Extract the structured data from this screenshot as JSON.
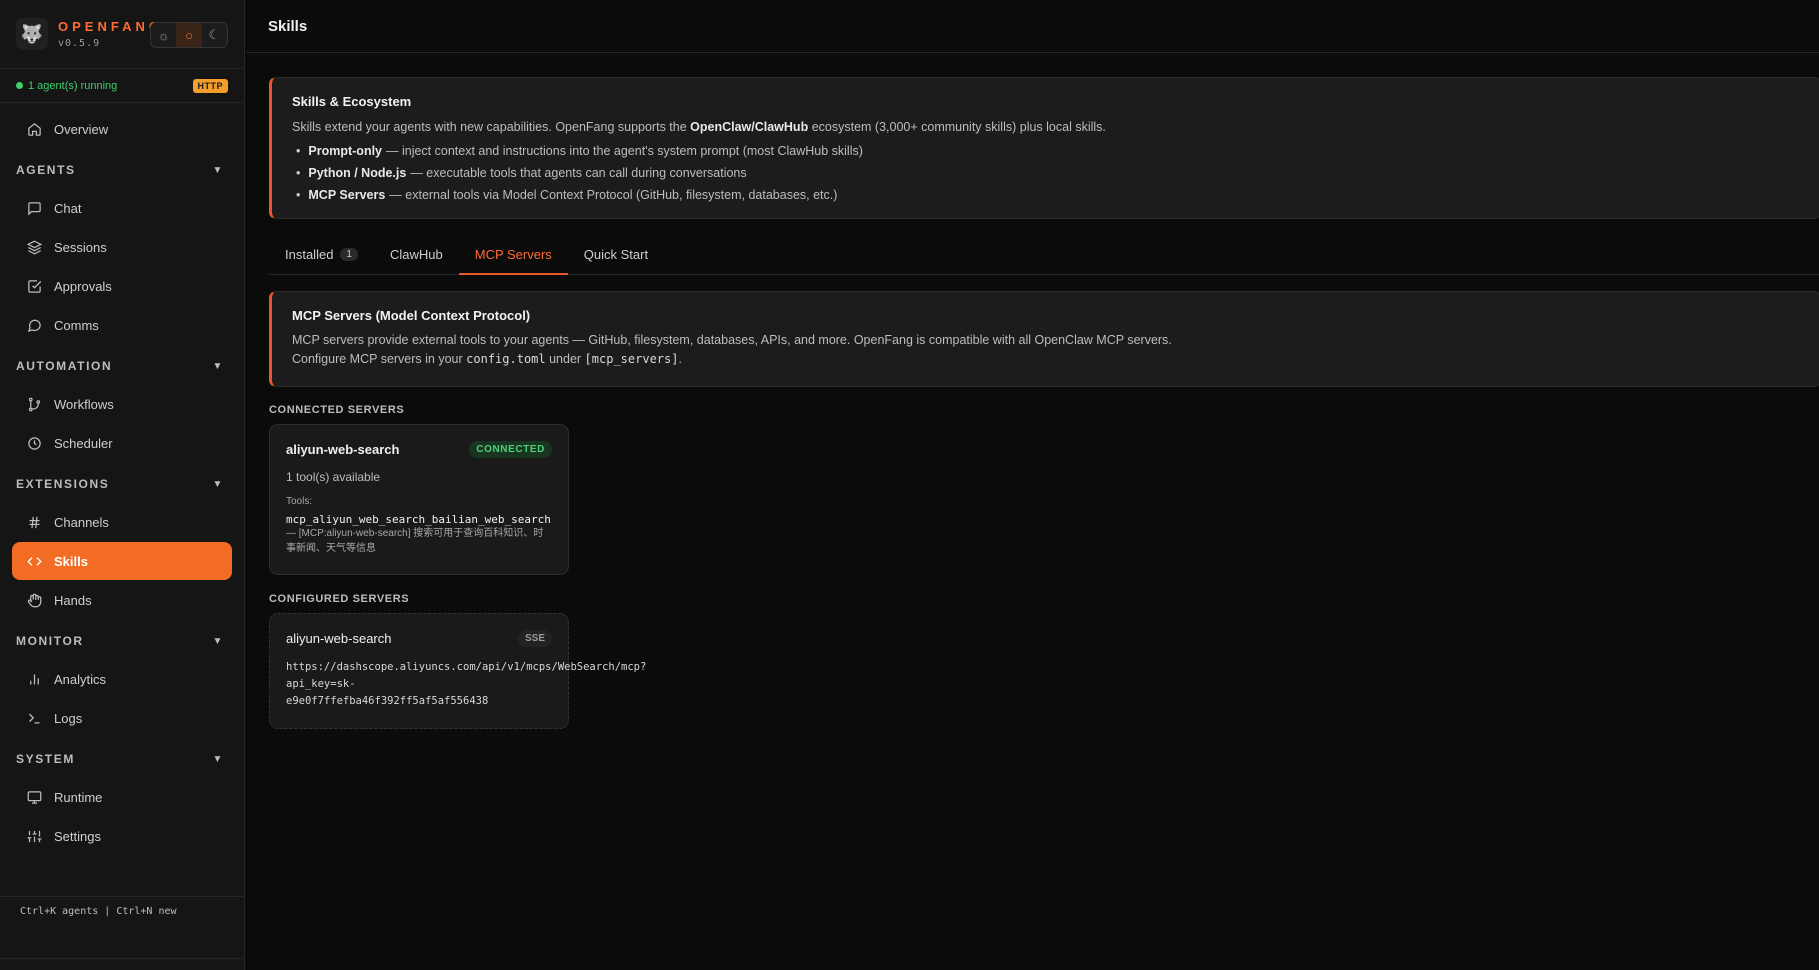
{
  "brand": {
    "name": "OPENFANG",
    "version": "v0.5.9"
  },
  "theme": {
    "light_icon": "sun-icon",
    "system_icon": "circle-icon",
    "dark_icon": "moon-icon",
    "active": "system"
  },
  "status": {
    "text": "1 agent(s) running",
    "badge": "HTTP"
  },
  "nav": {
    "overview": "Overview",
    "sections": {
      "agents": "AGENTS",
      "automation": "AUTOMATION",
      "extensions": "EXTENSIONS",
      "monitor": "MONITOR",
      "system": "SYSTEM"
    },
    "chat": "Chat",
    "sessions": "Sessions",
    "approvals": "Approvals",
    "comms": "Comms",
    "workflows": "Workflows",
    "scheduler": "Scheduler",
    "channels": "Channels",
    "skills": "Skills",
    "hands": "Hands",
    "analytics": "Analytics",
    "logs": "Logs",
    "runtime": "Runtime",
    "settings": "Settings"
  },
  "footer": {
    "shortcuts": "Ctrl+K agents | Ctrl+N new"
  },
  "page": {
    "title": "Skills"
  },
  "intro": {
    "title": "Skills & Ecosystem",
    "text_a": "Skills extend your agents with new capabilities. OpenFang supports the ",
    "text_bold": "OpenClaw/ClawHub",
    "text_b": " ecosystem (3,000+ community skills) plus local skills.",
    "bullets": [
      {
        "bold": "Prompt-only",
        "text": "— inject context and instructions into the agent's system prompt (most ClawHub skills)"
      },
      {
        "bold": "Python / Node.js",
        "text": "— executable tools that agents can call during conversations"
      },
      {
        "bold": "MCP Servers",
        "text": "— external tools via Model Context Protocol (GitHub, filesystem, databases, etc.)"
      }
    ]
  },
  "tabs": [
    {
      "label": "Installed",
      "count": "1"
    },
    {
      "label": "ClawHub"
    },
    {
      "label": "MCP Servers"
    },
    {
      "label": "Quick Start"
    }
  ],
  "mcp": {
    "title": "MCP Servers (Model Context Protocol)",
    "line1": "MCP servers provide external tools to your agents — GitHub, filesystem, databases, APIs, and more. OpenFang is compatible with all OpenClaw MCP servers.",
    "line2_a": "Configure MCP servers in your ",
    "line2_code1": "config.toml",
    "line2_b": " under ",
    "line2_code2": "[mcp_servers]",
    "line2_c": "."
  },
  "connected": {
    "label": "CONNECTED SERVERS",
    "server": {
      "name": "aliyun-web-search",
      "status": "CONNECTED",
      "tools_available": "1 tool(s) available",
      "tools_label": "Tools:",
      "tool_name": "mcp_aliyun_web_search_bailian_web_search",
      "tool_desc": "— [MCP:aliyun-web-search] 搜索可用于查询百科知识、时事新闻、天气等信息"
    }
  },
  "configured": {
    "label": "CONFIGURED SERVERS",
    "server": {
      "name": "aliyun-web-search",
      "transport": "SSE",
      "url_line1": "https://dashscope.aliyuncs.com/api/v1/mcps/WebSearch/mcp?",
      "url_line2": "api_key=sk-",
      "url_line3": "e9e0f7ffefba46f392ff5af5af556438"
    }
  }
}
